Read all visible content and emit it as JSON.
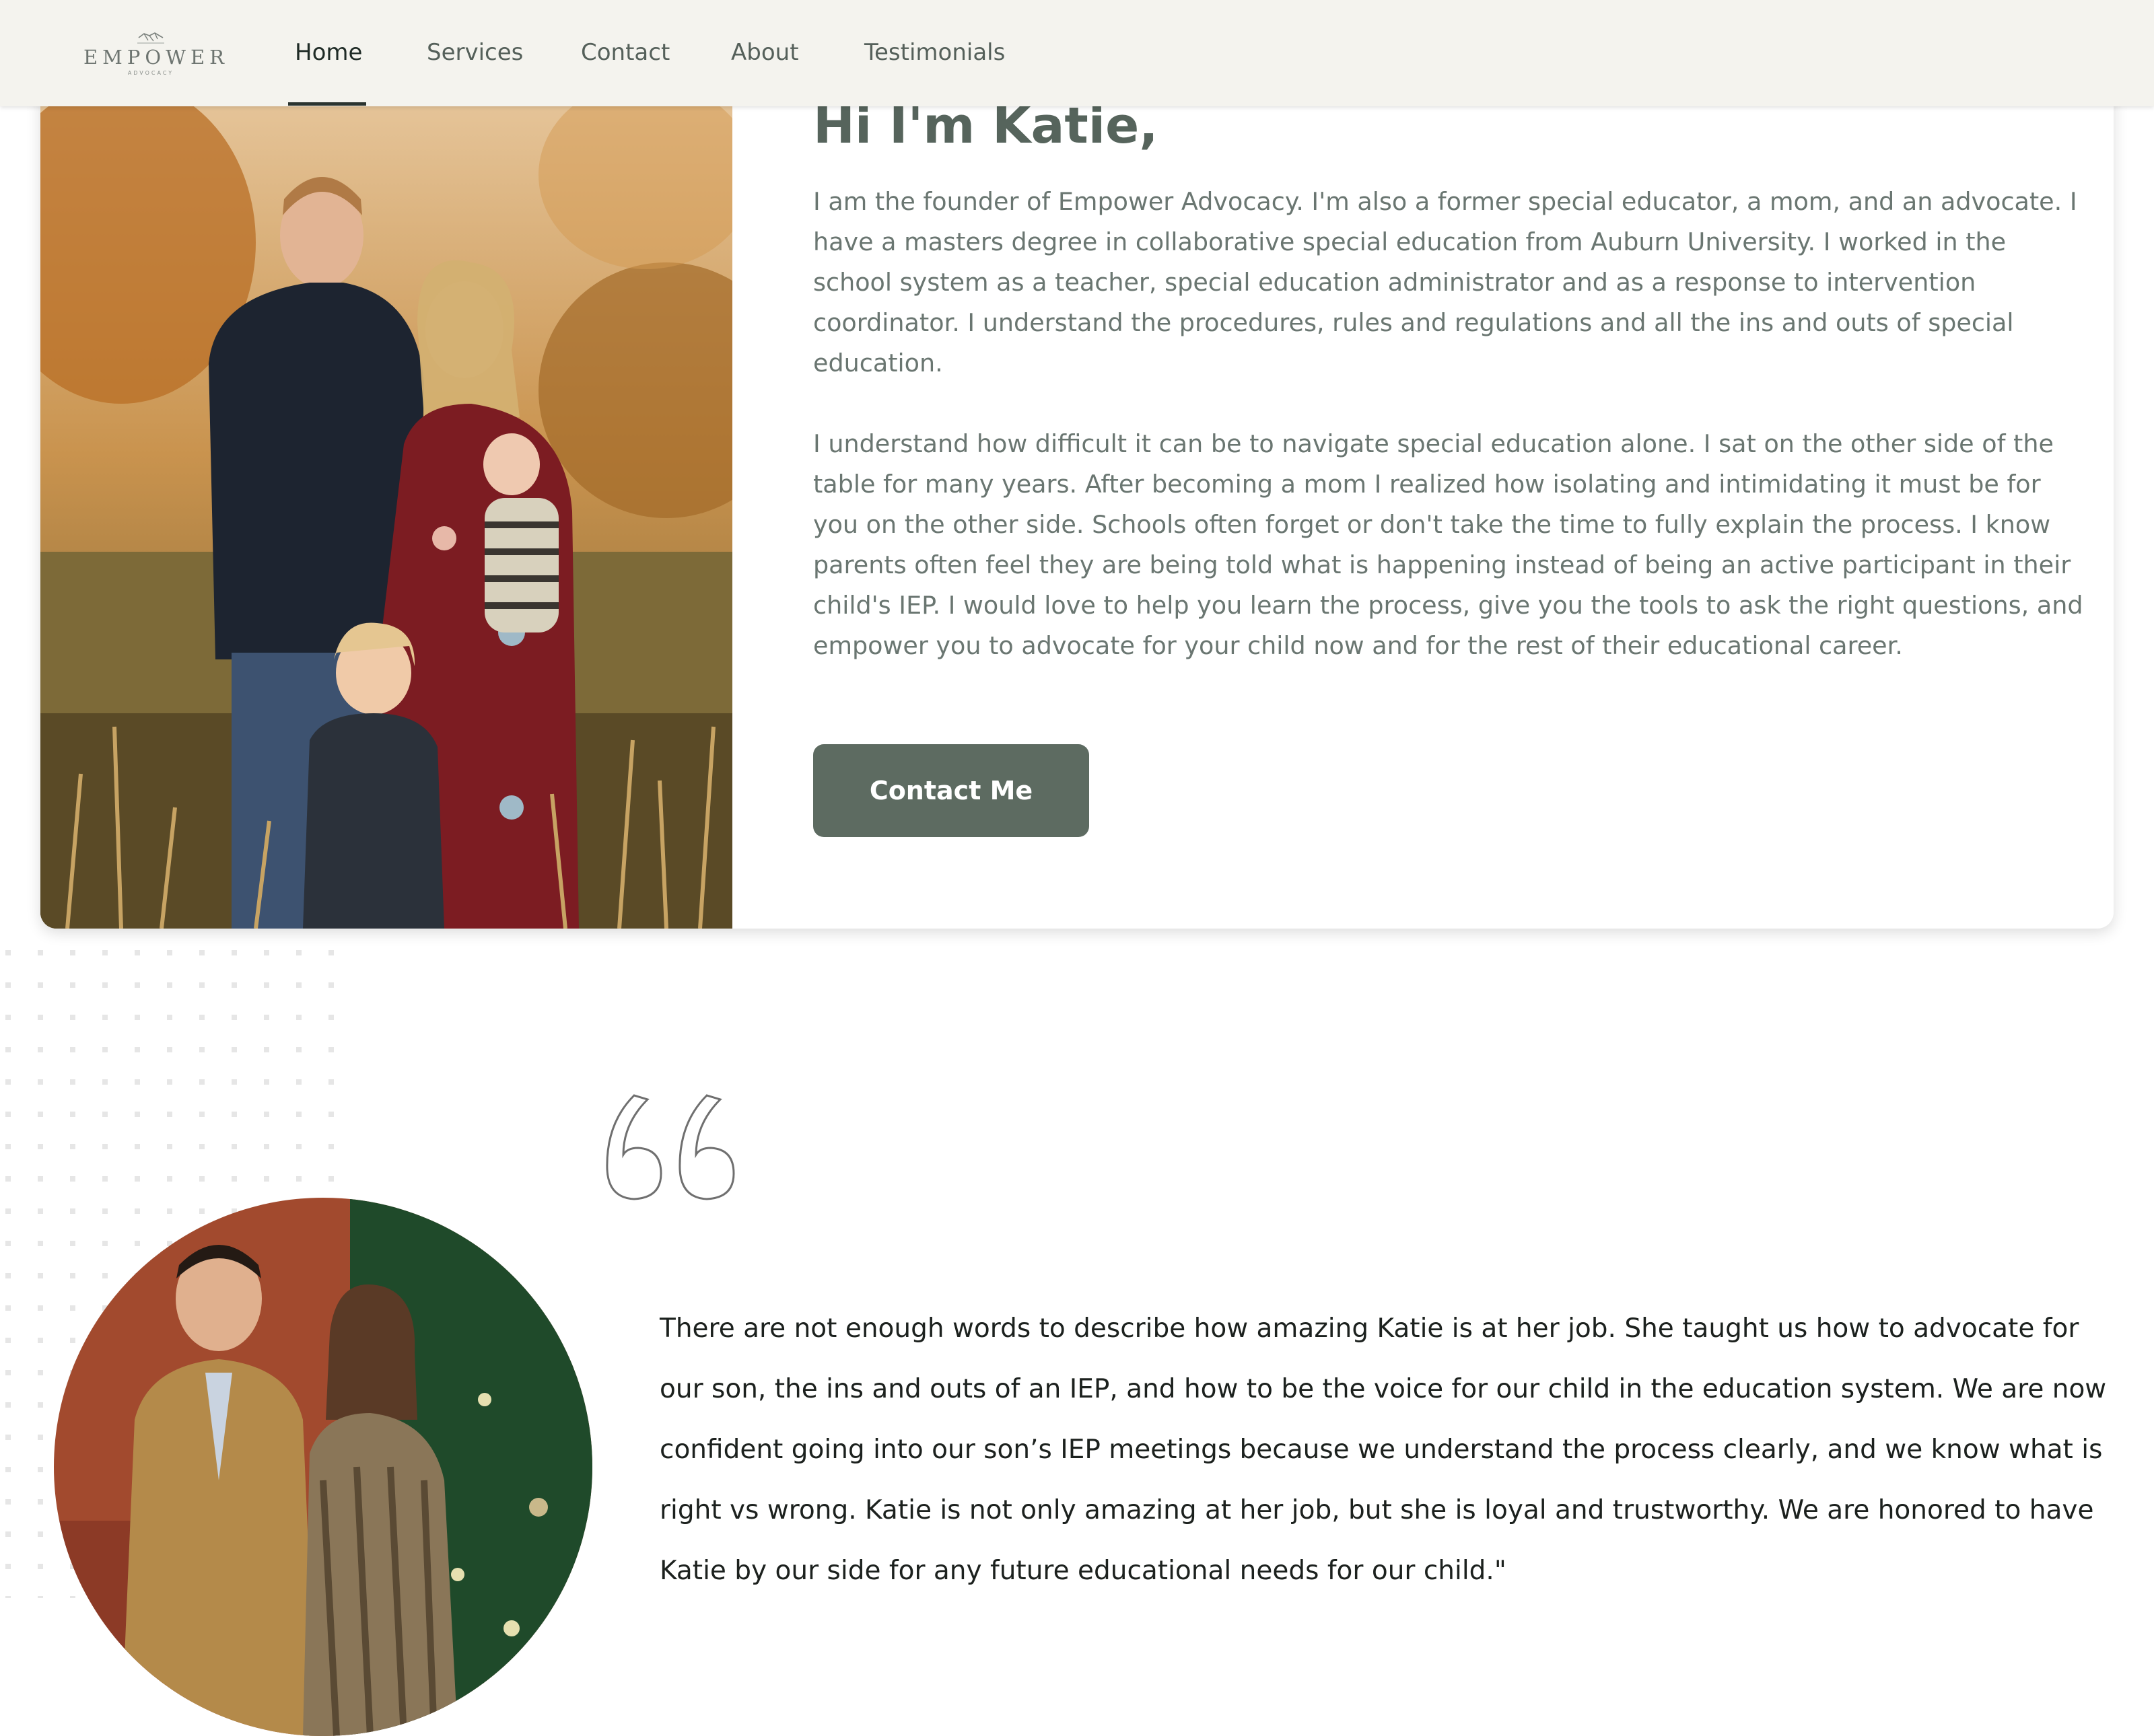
{
  "brand": {
    "name": "EMPOWER",
    "tagline": "ADVOCACY"
  },
  "nav": {
    "items": [
      {
        "label": "Home",
        "active": true
      },
      {
        "label": "Services",
        "active": false
      },
      {
        "label": "Contact",
        "active": false
      },
      {
        "label": "About",
        "active": false
      },
      {
        "label": "Testimonials",
        "active": false
      }
    ]
  },
  "about": {
    "title": "Hi I'm Katie,",
    "paragraphs": [
      "I am the founder of Empower Advocacy. I'm also a former special educator, a mom, and an advocate. I have a masters degree in collaborative special education from Auburn University. I worked in the school system as a teacher, special education administrator and as a response to intervention coordinator. I understand the procedures, rules and regulations and all the ins and outs of special education.",
      "I understand how difficult it can be to navigate special education alone. I sat on the other side of the table for many years. After becoming a mom I realized how isolating and intimidating it must be for you on the other side. Schools often forget or don't take the time to fully explain the process. I know parents often feel they are being told what is happening instead of being an active participant in their child's IEP. I would love to help you learn the process, give you the tools to ask the right questions, and empower you to advocate for your child now and for the rest of their educational career."
    ],
    "cta_label": "Contact Me"
  },
  "testimonial": {
    "quote": "There are not enough words to describe how amazing Katie is at her job. She taught us how to advocate for our son, the ins and outs of an IEP, and how to be the voice for our child in the education system. We are now confident going into our son’s IEP meetings because we understand the process clearly, and we know what is right vs wrong. Katie is not only amazing at her job, but she is loyal and trustworthy. We are honored to have Katie by our side for any future educational needs for our child.\""
  },
  "colors": {
    "nav_bg": "#f4f3ee",
    "accent": "#5d6b61",
    "title": "#56645c",
    "body_text": "#6a7671"
  }
}
